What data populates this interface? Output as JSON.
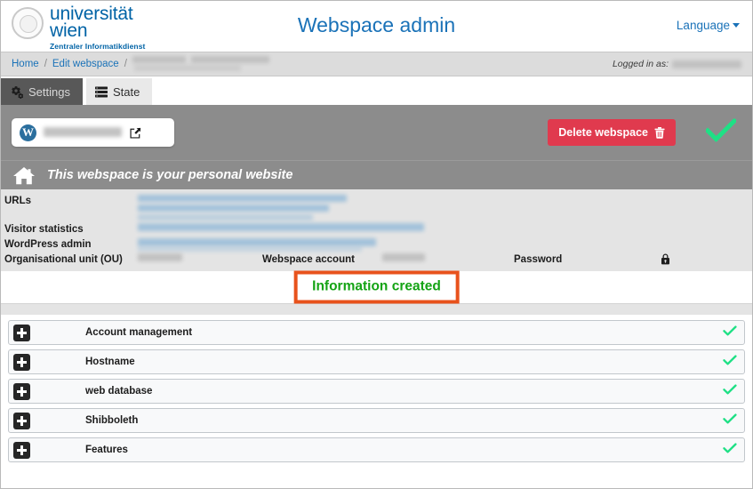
{
  "header": {
    "logo": {
      "line1": "universität",
      "line2": "wien",
      "subtitle": "Zentraler Informatikdienst"
    },
    "title": "Webspace admin",
    "language_label": "Language"
  },
  "breadcrumb": {
    "items": [
      {
        "label": "Home",
        "link": true
      },
      {
        "label": "Edit webspace",
        "link": true
      }
    ],
    "separator": "/",
    "redacted_trail": true,
    "logged_in_label": "Logged in as:"
  },
  "tabs": [
    {
      "label": "Settings",
      "icon": "gears-icon",
      "active": true
    },
    {
      "label": "State",
      "icon": "server-list-icon",
      "active": false
    }
  ],
  "action_band": {
    "site_pill": {
      "icon": "wordpress-icon",
      "icon_glyph": "W",
      "edit_icon": "edit-pencil-icon",
      "value_redacted": true
    },
    "delete_button": {
      "label": "Delete webspace",
      "icon": "trash-icon",
      "color": "#e03a4e"
    },
    "status_check": {
      "icon": "check-icon",
      "color": "#1fe085"
    }
  },
  "personal_banner": {
    "icon": "home-icon",
    "text": "This webspace is your personal website"
  },
  "info_panel": {
    "rows": [
      {
        "label": "URLs",
        "value_redacted": true
      },
      {
        "label": "Visitor statistics",
        "value_redacted": true
      },
      {
        "label": "WordPress admin",
        "value_redacted": true
      },
      {
        "label": "Organisational unit (OU)",
        "value_redacted": true
      }
    ],
    "columns": [
      {
        "label": "Webspace account",
        "value_redacted": true
      },
      {
        "label": "Password",
        "icon": "lock-icon"
      }
    ]
  },
  "notification": {
    "text": "Information created",
    "text_color": "#14a314",
    "border_color": "#e8521c"
  },
  "accordion": {
    "items": [
      {
        "label": "Account management",
        "expand_icon": "plus-icon",
        "status_icon": "check-icon"
      },
      {
        "label": "Hostname",
        "expand_icon": "plus-icon",
        "status_icon": "check-icon"
      },
      {
        "label": "web database",
        "expand_icon": "plus-icon",
        "status_icon": "check-icon"
      },
      {
        "label": "Shibboleth",
        "expand_icon": "plus-icon",
        "status_icon": "check-icon"
      },
      {
        "label": "Features",
        "expand_icon": "plus-icon",
        "status_icon": "check-icon"
      }
    ]
  },
  "colors": {
    "brand_blue": "#0063a6",
    "link_blue": "#1a72b8",
    "band_gray": "#8c8c8c",
    "panel_gray": "#e4e4e4",
    "check_green": "#1fe085",
    "danger_red": "#e03a4e",
    "highlight_orange": "#e8521c",
    "success_green": "#14a314"
  }
}
